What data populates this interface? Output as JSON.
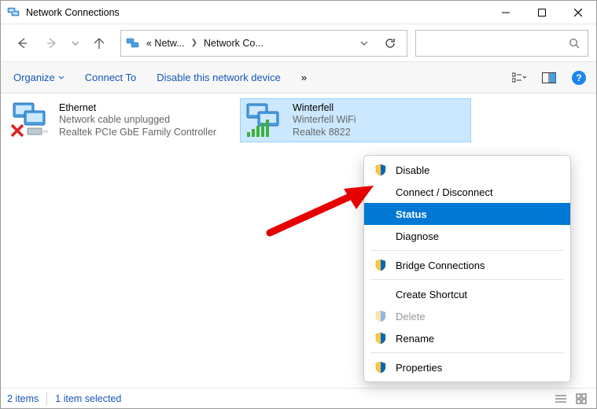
{
  "titlebar": {
    "title": "Network Connections"
  },
  "breadcrumb": {
    "seg1": "« Netw...",
    "seg2": "Network Co..."
  },
  "cmdbar": {
    "organize": "Organize",
    "connect_to": "Connect To",
    "disable_device": "Disable this network device",
    "overflow": "»"
  },
  "connections": {
    "ethernet": {
      "name": "Ethernet",
      "status": "Network cable unplugged",
      "adapter": "Realtek PCIe GbE Family Controller"
    },
    "wifi": {
      "name": "Winterfell",
      "status": "Winterfell WiFi",
      "adapter": "Realtek 8822"
    }
  },
  "context_menu": {
    "disable": "Disable",
    "connect_disconnect": "Connect / Disconnect",
    "status": "Status",
    "diagnose": "Diagnose",
    "bridge": "Bridge Connections",
    "create_shortcut": "Create Shortcut",
    "delete": "Delete",
    "rename": "Rename",
    "properties": "Properties"
  },
  "statusbar": {
    "count": "2 items",
    "selected": "1 item selected"
  }
}
